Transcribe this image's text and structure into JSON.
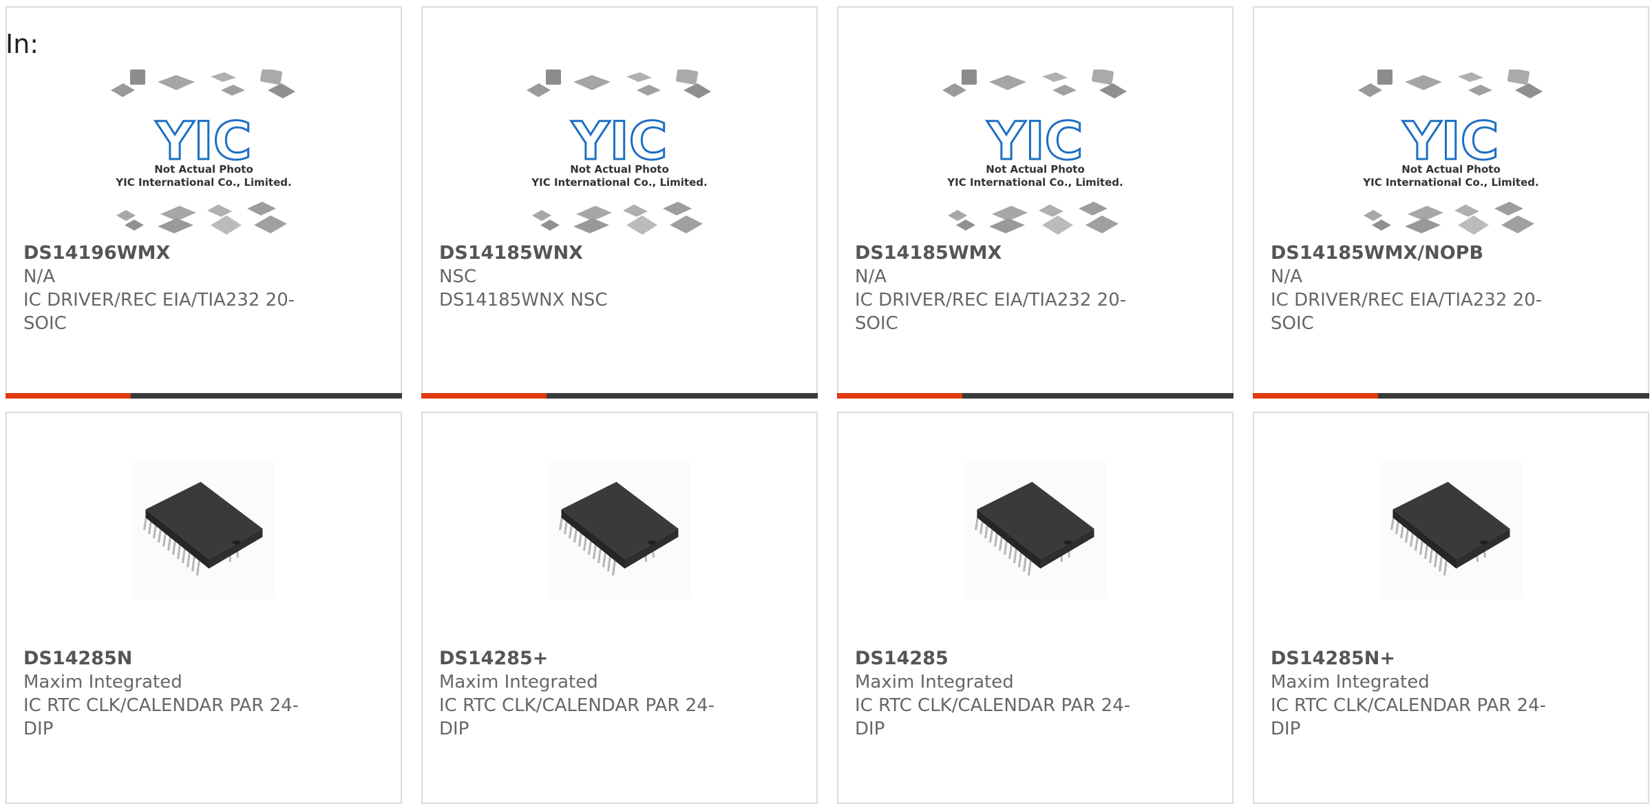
{
  "header": {
    "in_label": "In:"
  },
  "placeholder_photo": {
    "caption1": "Not Actual Photo",
    "caption2": "YIC International Co., Limited.",
    "logo_text": "YIC"
  },
  "colors": {
    "accent": "#e03a10",
    "bar": "#3a3a3a",
    "chip": "#333333"
  },
  "products": [
    {
      "part": "DS14196WMX",
      "manufacturer": "N/A",
      "desc1": "IC DRIVER/REC EIA/TIA232 20-",
      "desc2": "SOIC",
      "image": "not-actual-photo"
    },
    {
      "part": "DS14185WNX",
      "manufacturer": "NSC",
      "desc1": "DS14185WNX NSC",
      "desc2": "",
      "image": "not-actual-photo"
    },
    {
      "part": "DS14185WMX",
      "manufacturer": "N/A",
      "desc1": "IC DRIVER/REC EIA/TIA232 20-",
      "desc2": "SOIC",
      "image": "not-actual-photo"
    },
    {
      "part": "DS14185WMX/NOPB",
      "manufacturer": "N/A",
      "desc1": "IC DRIVER/REC EIA/TIA232 20-",
      "desc2": "SOIC",
      "image": "not-actual-photo"
    },
    {
      "part": "DS14285N",
      "manufacturer": "Maxim Integrated",
      "desc1": "IC RTC CLK/CALENDAR PAR 24-",
      "desc2": "DIP",
      "image": "dip-chip"
    },
    {
      "part": "DS14285+",
      "manufacturer": "Maxim Integrated",
      "desc1": "IC RTC CLK/CALENDAR PAR 24-",
      "desc2": "DIP",
      "image": "dip-chip"
    },
    {
      "part": "DS14285",
      "manufacturer": "Maxim Integrated",
      "desc1": "IC RTC CLK/CALENDAR PAR 24-",
      "desc2": "DIP",
      "image": "dip-chip"
    },
    {
      "part": "DS14285N+",
      "manufacturer": "Maxim Integrated",
      "desc1": "IC RTC CLK/CALENDAR PAR 24-",
      "desc2": "DIP",
      "image": "dip-chip"
    }
  ]
}
